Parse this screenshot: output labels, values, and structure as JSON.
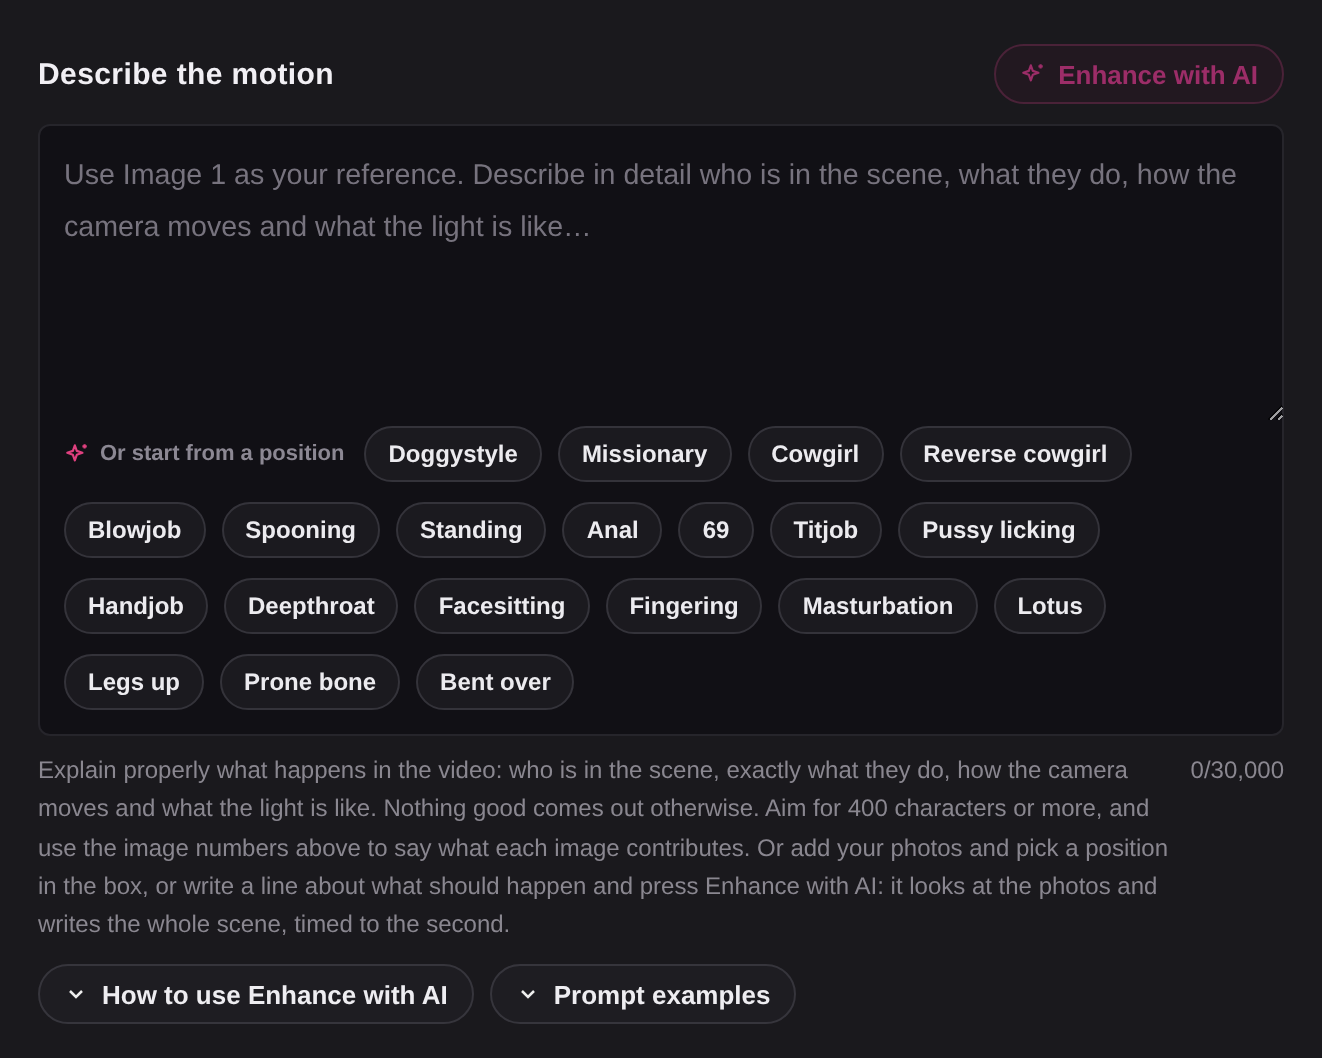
{
  "title": "Describe the motion",
  "enhance_button": {
    "label": "Enhance with AI",
    "disabled": true
  },
  "prompt_field": {
    "placeholder": "Use Image 1 as your reference. Describe in detail who is in the scene, what they do, how the camera moves and what the light is like…"
  },
  "positions_label": "Or start from a position",
  "positions": [
    {
      "label": "Doggystyle"
    },
    {
      "label": "Missionary"
    },
    {
      "label": "Cowgirl"
    },
    {
      "label": "Reverse cowgirl"
    },
    {
      "label": "Blowjob"
    },
    {
      "label": "Spooning"
    },
    {
      "label": "Standing"
    },
    {
      "label": "Anal"
    },
    {
      "label": "69"
    },
    {
      "label": "Titjob"
    },
    {
      "label": "Pussy licking"
    },
    {
      "label": "Handjob"
    },
    {
      "label": "Deepthroat"
    },
    {
      "label": "Facesitting"
    },
    {
      "label": "Fingering"
    },
    {
      "label": "Masturbation"
    },
    {
      "label": "Lotus"
    },
    {
      "label": "Legs up"
    },
    {
      "label": "Prone bone"
    },
    {
      "label": "Bent over"
    }
  ],
  "help_text": "Explain properly what happens in the video: who is in the scene, exactly what they do, how the camera moves and what the light is like. Nothing good comes out otherwise. Aim for 400 characters or more, and use the image numbers above to say what each image contributes. Or add your photos and pick a position in the box, or write a line about what should happen and press Enhance with AI: it looks at the photos and writes the whole scene, timed to the second.",
  "char_count": "0/30,000",
  "toggles": [
    {
      "label": "How to use Enhance with AI",
      "expanded": false
    },
    {
      "label": "Prompt examples",
      "expanded": false
    }
  ]
}
